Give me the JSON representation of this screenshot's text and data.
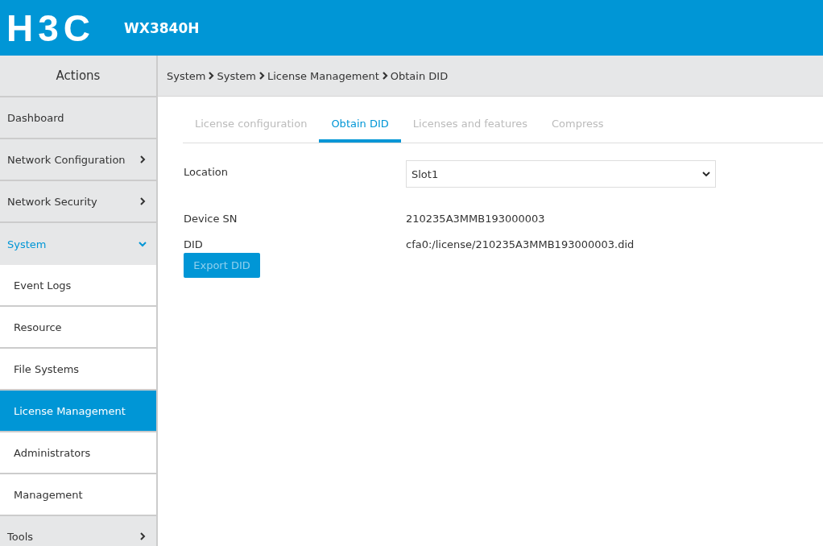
{
  "header": {
    "logo": "H3C",
    "model": "WX3840H"
  },
  "sidebar": {
    "title": "Actions",
    "items": [
      {
        "label": "Dashboard"
      },
      {
        "label": "Network Configuration",
        "expanded": false
      },
      {
        "label": "Network Security",
        "expanded": false
      },
      {
        "label": "System",
        "expanded": true,
        "children": [
          {
            "label": "Event Logs",
            "selected": false
          },
          {
            "label": "Resource",
            "selected": false
          },
          {
            "label": "File Systems",
            "selected": false
          },
          {
            "label": "License Management",
            "selected": true
          },
          {
            "label": "Administrators",
            "selected": false
          },
          {
            "label": "Management",
            "selected": false
          }
        ]
      },
      {
        "label": "Tools",
        "expanded": false
      }
    ]
  },
  "breadcrumb": [
    "System",
    "System",
    "License Management",
    "Obtain DID"
  ],
  "tabs": [
    {
      "label": "License configuration",
      "selected": false
    },
    {
      "label": "Obtain DID",
      "selected": true
    },
    {
      "label": "Licenses and features",
      "selected": false
    },
    {
      "label": "Compress",
      "selected": false
    }
  ],
  "form": {
    "location": {
      "label": "Location",
      "value": "Slot1"
    },
    "device_sn": {
      "label": "Device SN",
      "value": "210235A3MMB193000003"
    },
    "did": {
      "label": "DID",
      "value": "cfa0:/license/210235A3MMB193000003.did"
    },
    "button": "Export DID"
  }
}
